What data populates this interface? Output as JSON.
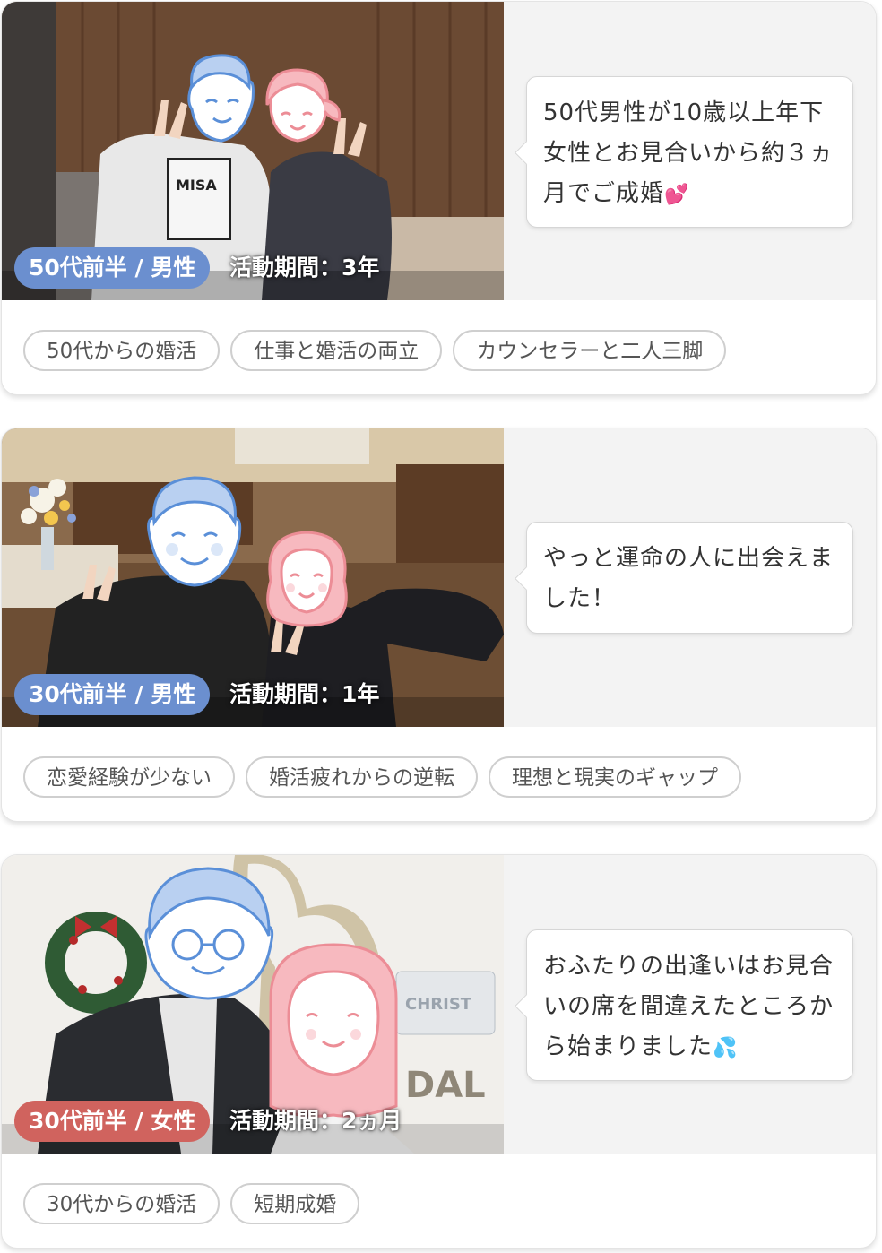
{
  "colors": {
    "male_badge": "#6b8fcf",
    "female_badge": "#d0635e"
  },
  "cards": [
    {
      "age_badge": "50代前半 / 男性",
      "gender": "male",
      "period": "活動期間：3年",
      "message": "50代男性が10歳以上年下女性とお見合いから約３ヵ月でご成婚",
      "emoji": "💕",
      "tags": [
        "50代からの婚活",
        "仕事と婚活の両立",
        "カウンセラーと二人三脚"
      ]
    },
    {
      "age_badge": "30代前半 / 男性",
      "gender": "male",
      "period": "活動期間：1年",
      "message": "やっと運命の人に出会えました！",
      "emoji": "",
      "tags": [
        "恋愛経験が少ない",
        "婚活疲れからの逆転",
        "理想と現実のギャップ"
      ]
    },
    {
      "age_badge": "30代前半 / 女性",
      "gender": "female",
      "period": "活動期間：2ヵ月",
      "message": "おふたりの出逢いはお見合いの席を間違えたところから始まりました",
      "emoji": "💦",
      "tags": [
        "30代からの婚活",
        "短期成婚"
      ]
    }
  ]
}
